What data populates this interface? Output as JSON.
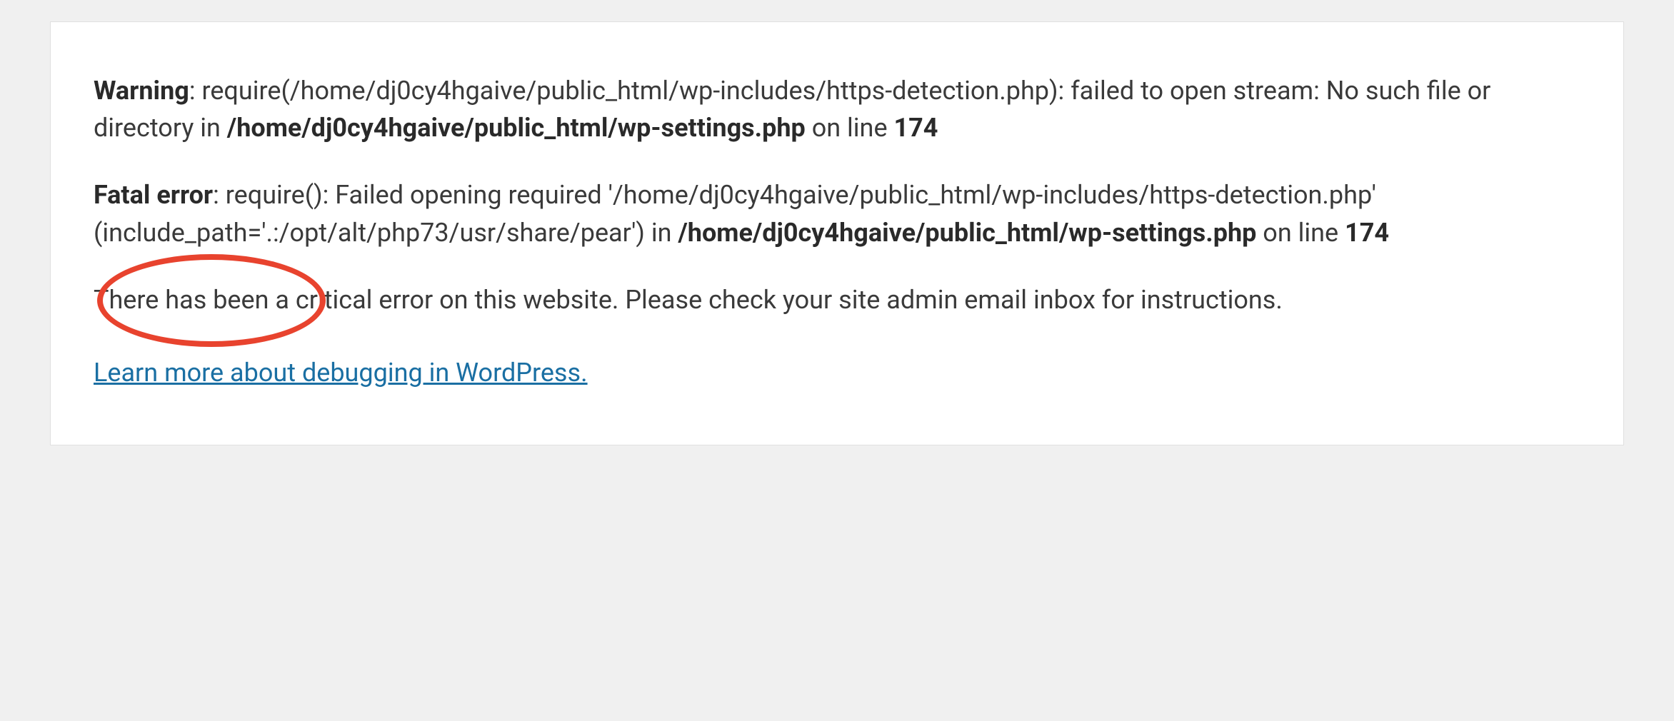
{
  "warning": {
    "label": "Warning",
    "text_1": ": require(/home/dj0cy4hgaive/public_html/wp-includes/https-detection.php): failed to open stream: No such file or directory in ",
    "path": "/home/dj0cy4hgaive/public_html/wp-settings.php",
    "text_2": " on line ",
    "line": "174"
  },
  "fatal": {
    "label": "Fatal error",
    "text_1": ": require(): Failed opening required '/home/dj0cy4hgaive/public_html/wp-includes/https-detection.php' (include_path='.:/opt/alt/php73/usr/share/pear') in ",
    "path": "/home/dj0cy4hgaive/public_html/wp-settings.php",
    "text_2": " on line ",
    "line": "174"
  },
  "critical_message": "There has been a critical error on this website. Please check your site admin email inbox for instructions.",
  "link_text": "Learn more about debugging in WordPress."
}
